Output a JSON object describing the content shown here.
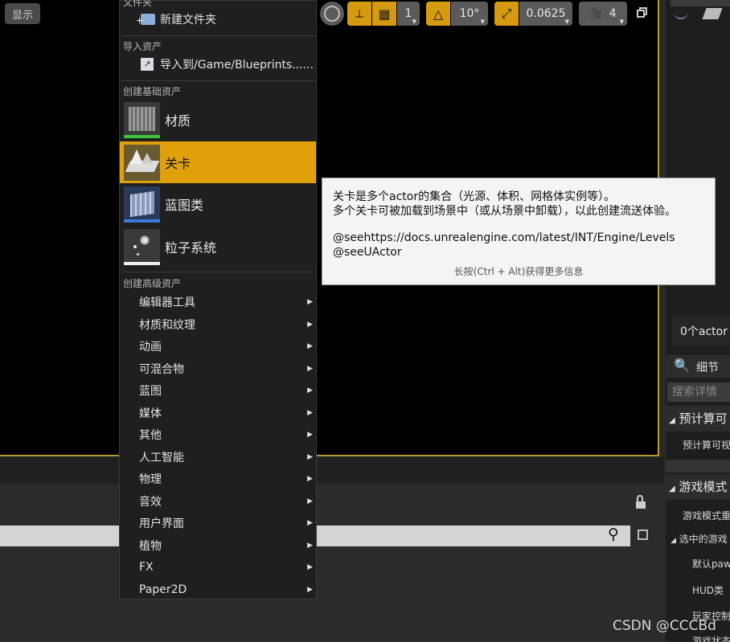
{
  "viewport": {
    "show_label": "显示",
    "toolbar": {
      "grid_snap_value": "1",
      "rotation_snap_value": "10°",
      "scale_snap_value": "0.0625",
      "camera_speed_value": "4"
    }
  },
  "menu": {
    "top_cut_label": "文件夹",
    "new_folder_label": "新建文件夹",
    "import_section": "导入资产",
    "import_item": "导入到/Game/Blueprints......",
    "basic_section": "创建基础资产",
    "basic_items": [
      {
        "label": "材质",
        "icon": "material-icon"
      },
      {
        "label": "关卡",
        "icon": "level-icon",
        "selected": true
      },
      {
        "label": "蓝图类",
        "icon": "blueprint-class-icon"
      },
      {
        "label": "粒子系统",
        "icon": "particle-system-icon"
      }
    ],
    "advanced_section": "创建高级资产",
    "advanced_items": [
      "编辑器工具",
      "材质和纹理",
      "动画",
      "可混合物",
      "蓝图",
      "媒体",
      "其他",
      "人工智能",
      "物理",
      "音效",
      "用户界面",
      "植物",
      "FX",
      "Paper2D"
    ],
    "submenu_arrow": "▶"
  },
  "tooltip": {
    "line1": "关卡是多个actor的集合（光源、体积、网格体实例等）。",
    "line2": "多个关卡可被加载到场景中（或从场景中卸载），以此创建流送体验。",
    "line3": "@seehttps://docs.unrealengine.com/latest/INT/Engine/Levels",
    "line4": "@seeUActor",
    "hint": "长按(Ctrl + Alt)获得更多信息"
  },
  "right_panel": {
    "actor_count": "0个actor",
    "details_tab": "细节",
    "search_placeholder": "搜索详情",
    "cat1": "预计算可",
    "cat1_row": "预计算可视",
    "cat2": "游戏模式",
    "cat2_row": "游戏模式重",
    "cat3": "选中的游戏",
    "rows": [
      "默认paw",
      "HUD类",
      "玩家控制",
      "游戏状态"
    ]
  },
  "watermark": "CSDN @CCCBd",
  "colors": {
    "accent": "#e0a00a",
    "viewport_border": "#b89a3a"
  }
}
